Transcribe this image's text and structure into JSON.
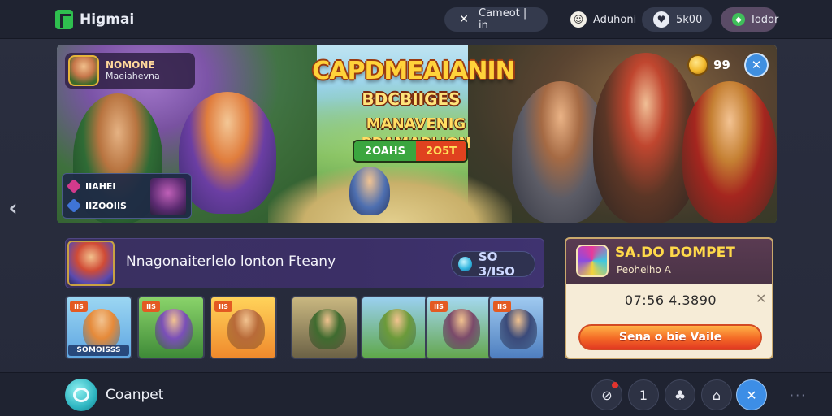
{
  "brand": {
    "name": "Higmai"
  },
  "topbar": {
    "pills": [
      {
        "label": "Cameot | in",
        "icon": "swords-icon"
      },
      {
        "label": "Aduhoni",
        "icon": "chef-avatar-icon"
      },
      {
        "label": "5k00",
        "icon": "heart-icon"
      },
      {
        "label": "Iodor",
        "icon": "gem-icon"
      }
    ]
  },
  "hero": {
    "title": "CAPDMEAIANIN",
    "subtitle": "BDCBIIGES",
    "tagline": "MANAVENIG PRAMABLION",
    "badge_left": "2OAHS",
    "badge_right": "2O5T",
    "user": {
      "name": "NOMONE",
      "sub": "Maeiahevna"
    },
    "coins": "99",
    "stats": [
      {
        "label": "IIAHEI",
        "color": "#d23a8c"
      },
      {
        "label": "IIZOOIIS",
        "color": "#3f74d6"
      }
    ]
  },
  "promo": {
    "text": "Nnagonaiterlelo lonton Fteany",
    "price": "SO 3/ISO"
  },
  "cards": [
    {
      "tag": "IIS",
      "label": "SOMOISSS",
      "bg": "linear-gradient(180deg,#9bd6f2 0%,#5fa6e2 100%)",
      "fig": "#e58a3a"
    },
    {
      "tag": "IIS",
      "label": "",
      "bg": "linear-gradient(180deg,#8ad36a 0%,#3f8b38 100%)",
      "fig": "#7a4fb8"
    },
    {
      "tag": "IIS",
      "label": "",
      "bg": "linear-gradient(180deg,#ffd35a 0%,#f08a2c 100%)",
      "fig": "#b86a38"
    },
    {
      "tag": "",
      "label": "",
      "bg": "linear-gradient(180deg,#c9b780 0%,#6c6246 100%)",
      "fig": "#3f6b2f"
    },
    {
      "tag": "",
      "label": "",
      "bg": "linear-gradient(180deg,#9ad0f0 0%,#5fa84a 100%)",
      "fig": "#6b9a3a"
    },
    {
      "tag": "IIS",
      "label": "",
      "bg": "linear-gradient(180deg,#a4d8ef 0%,#64a64f 100%)",
      "fig": "#7a4a6a"
    },
    {
      "tag": "IIS",
      "label": "",
      "bg": "linear-gradient(180deg,#9fcaf0 0%,#4f7fc0 100%)",
      "fig": "#3a4a7a"
    }
  ],
  "panel": {
    "title": "SA.DO DOMPET",
    "subtitle": "Peoheiho A",
    "value": "07:56 4.3890",
    "cta": "Sena o bie Vaile"
  },
  "bottombar": {
    "label": "Coanpet",
    "buttons": [
      {
        "icon": "search-notification-icon",
        "text": "⊘"
      },
      {
        "icon": "number-one-icon",
        "text": "1"
      },
      {
        "icon": "party-icon",
        "text": "♣"
      },
      {
        "icon": "car-icon",
        "text": "⌂"
      },
      {
        "icon": "swords-active-icon",
        "text": "✕"
      }
    ]
  }
}
